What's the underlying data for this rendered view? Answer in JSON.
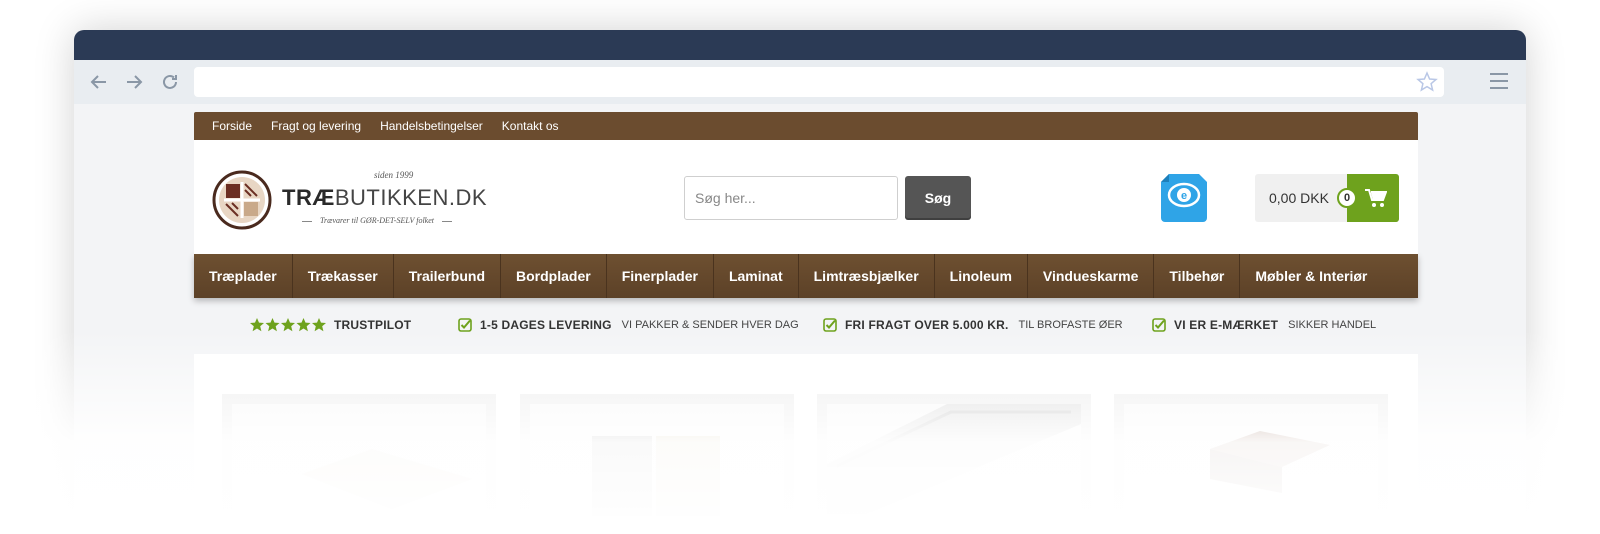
{
  "topbar": {
    "links": [
      "Forside",
      "Fragt og levering",
      "Handelsbetingelser",
      "Kontakt os"
    ]
  },
  "logo": {
    "since": "siden 1999",
    "brand_bold": "TRÆ",
    "brand_rest": "BUTIKKEN.DK",
    "tagline": "Trævarer til GØR-DET-SELV folket"
  },
  "search": {
    "placeholder": "Søg her...",
    "button_label": "Søg"
  },
  "emaerket": {
    "label": "e-mærket"
  },
  "cart": {
    "total": "0,00 DKK",
    "count": "0"
  },
  "mainnav": {
    "items": [
      "Træplader",
      "Trækasser",
      "Trailerbund",
      "Bordplader",
      "Finerplader",
      "Laminat",
      "Limtræsbjælker",
      "Linoleum",
      "Vindueskarme",
      "Tilbehør",
      "Møbler & Interiør"
    ]
  },
  "usps": {
    "trustpilot": "TRUSTPILOT",
    "items": [
      {
        "title": "1-5 DAGES LEVERING",
        "sub": "VI PAKKER & SENDER HVER DAG"
      },
      {
        "title": "FRI FRAGT OVER 5.000 KR.",
        "sub": "TIL BROFASTE ØER"
      },
      {
        "title": "VI ER E-MÆRKET",
        "sub": "SIKKER HANDEL"
      }
    ]
  },
  "colors": {
    "brown": "#6b4c2f",
    "green": "#6ea21d",
    "browser_title": "#2b3a55",
    "emaerket_blue": "#2fa4e7"
  }
}
